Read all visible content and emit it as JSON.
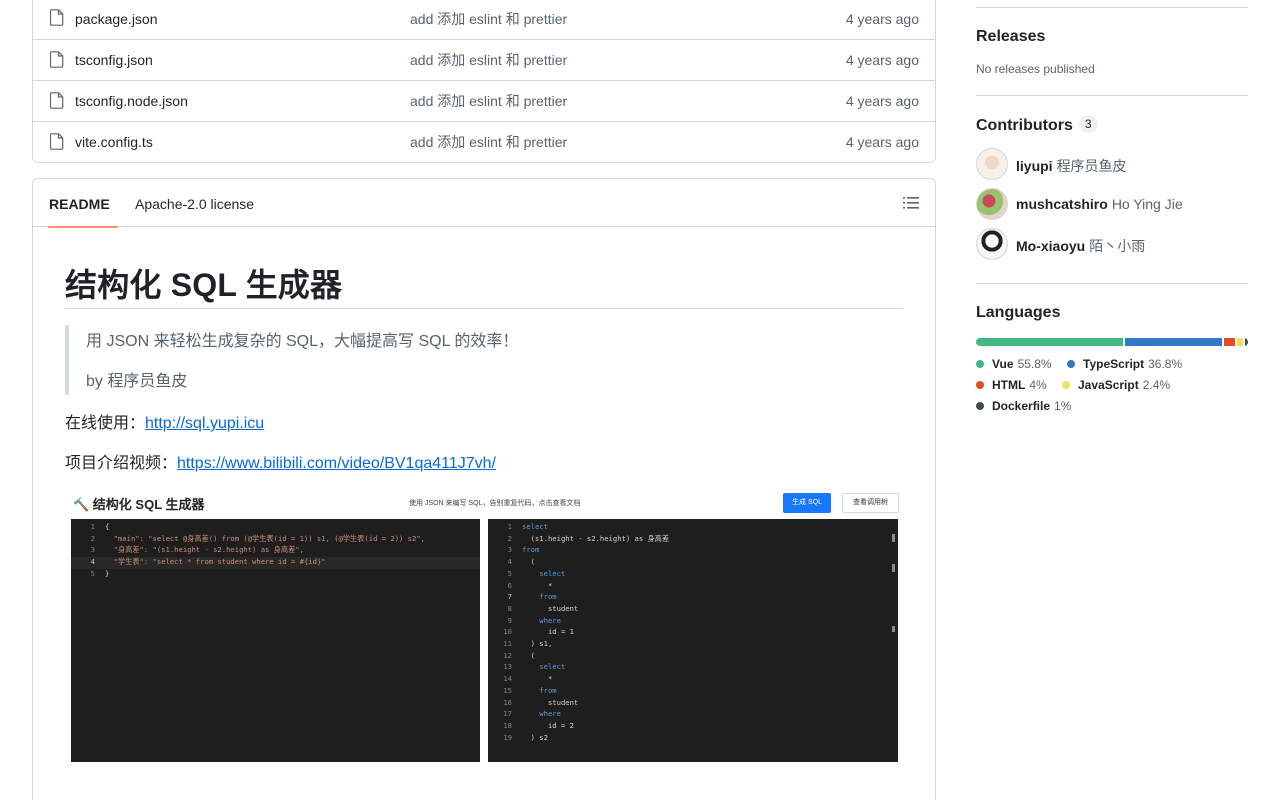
{
  "files": [
    {
      "name": "package.json",
      "message": "add 添加 eslint 和 prettier",
      "time": "4 years ago"
    },
    {
      "name": "tsconfig.json",
      "message": "add 添加 eslint 和 prettier",
      "time": "4 years ago"
    },
    {
      "name": "tsconfig.node.json",
      "message": "add 添加 eslint 和 prettier",
      "time": "4 years ago"
    },
    {
      "name": "vite.config.ts",
      "message": "add 添加 eslint 和 prettier",
      "time": "4 years ago"
    }
  ],
  "readme": {
    "tabs": [
      "README",
      "Apache-2.0 license"
    ],
    "title": "结构化 SQL 生成器",
    "quote": [
      "用 JSON 来轻松生成复杂的 SQL，大幅提高写 SQL 的效率！",
      "by 程序员鱼皮"
    ],
    "online_label": "在线使用：",
    "online_link": "http://sql.yupi.icu",
    "video_label": "项目介绍视频：",
    "video_link": "https://www.bilibili.com/video/BV1qa411J7vh/",
    "screenshot": {
      "title": "🔨 结构化 SQL 生成器",
      "hint": "使用 JSON 来编写 SQL，告别重复代码，点击查看文档",
      "btn_generate": "生成 SQL",
      "btn_examples": "查看调用树",
      "left_code": [
        "{",
        "  \"main\": \"select @身高差() from (@学生表(id = 1)) s1, (@学生表(id = 2)) s2\",",
        "  \"身高差\": \"(s1.height - s2.height) as 身高差\",",
        "  \"学生表\": \"select * from student where id = #{id}\"",
        "}"
      ],
      "right_code": [
        "select",
        "  (s1.height - s2.height) as 身高差",
        "from",
        "  (",
        "    select",
        "      *",
        "    from",
        "      student",
        "    where",
        "      id = 1",
        "  ) s1,",
        "  (",
        "    select",
        "      *",
        "    from",
        "      student",
        "    where",
        "      id = 2",
        "  ) s2"
      ]
    }
  },
  "sidebar": {
    "releases_title": "Releases",
    "releases_sub": "No releases published",
    "contributors_title": "Contributors",
    "contributors_count": "3",
    "contributors": [
      {
        "login": "liyupi",
        "name": "程序员鱼皮"
      },
      {
        "login": "mushcatshiro",
        "name": "Ho Ying Jie"
      },
      {
        "login": "Mo-xiaoyu",
        "name": "陌丶小雨"
      }
    ],
    "languages_title": "Languages",
    "languages": [
      {
        "name": "Vue",
        "percent": "55.8%",
        "value": 55.8,
        "color": "#41b883"
      },
      {
        "name": "TypeScript",
        "percent": "36.8%",
        "value": 36.8,
        "color": "#3178c6"
      },
      {
        "name": "HTML",
        "percent": "4%",
        "value": 4,
        "color": "#e34c26"
      },
      {
        "name": "JavaScript",
        "percent": "2.4%",
        "value": 2.4,
        "color": "#f1e05a"
      },
      {
        "name": "Dockerfile",
        "percent": "1%",
        "value": 1,
        "color": "#384d54"
      }
    ]
  }
}
